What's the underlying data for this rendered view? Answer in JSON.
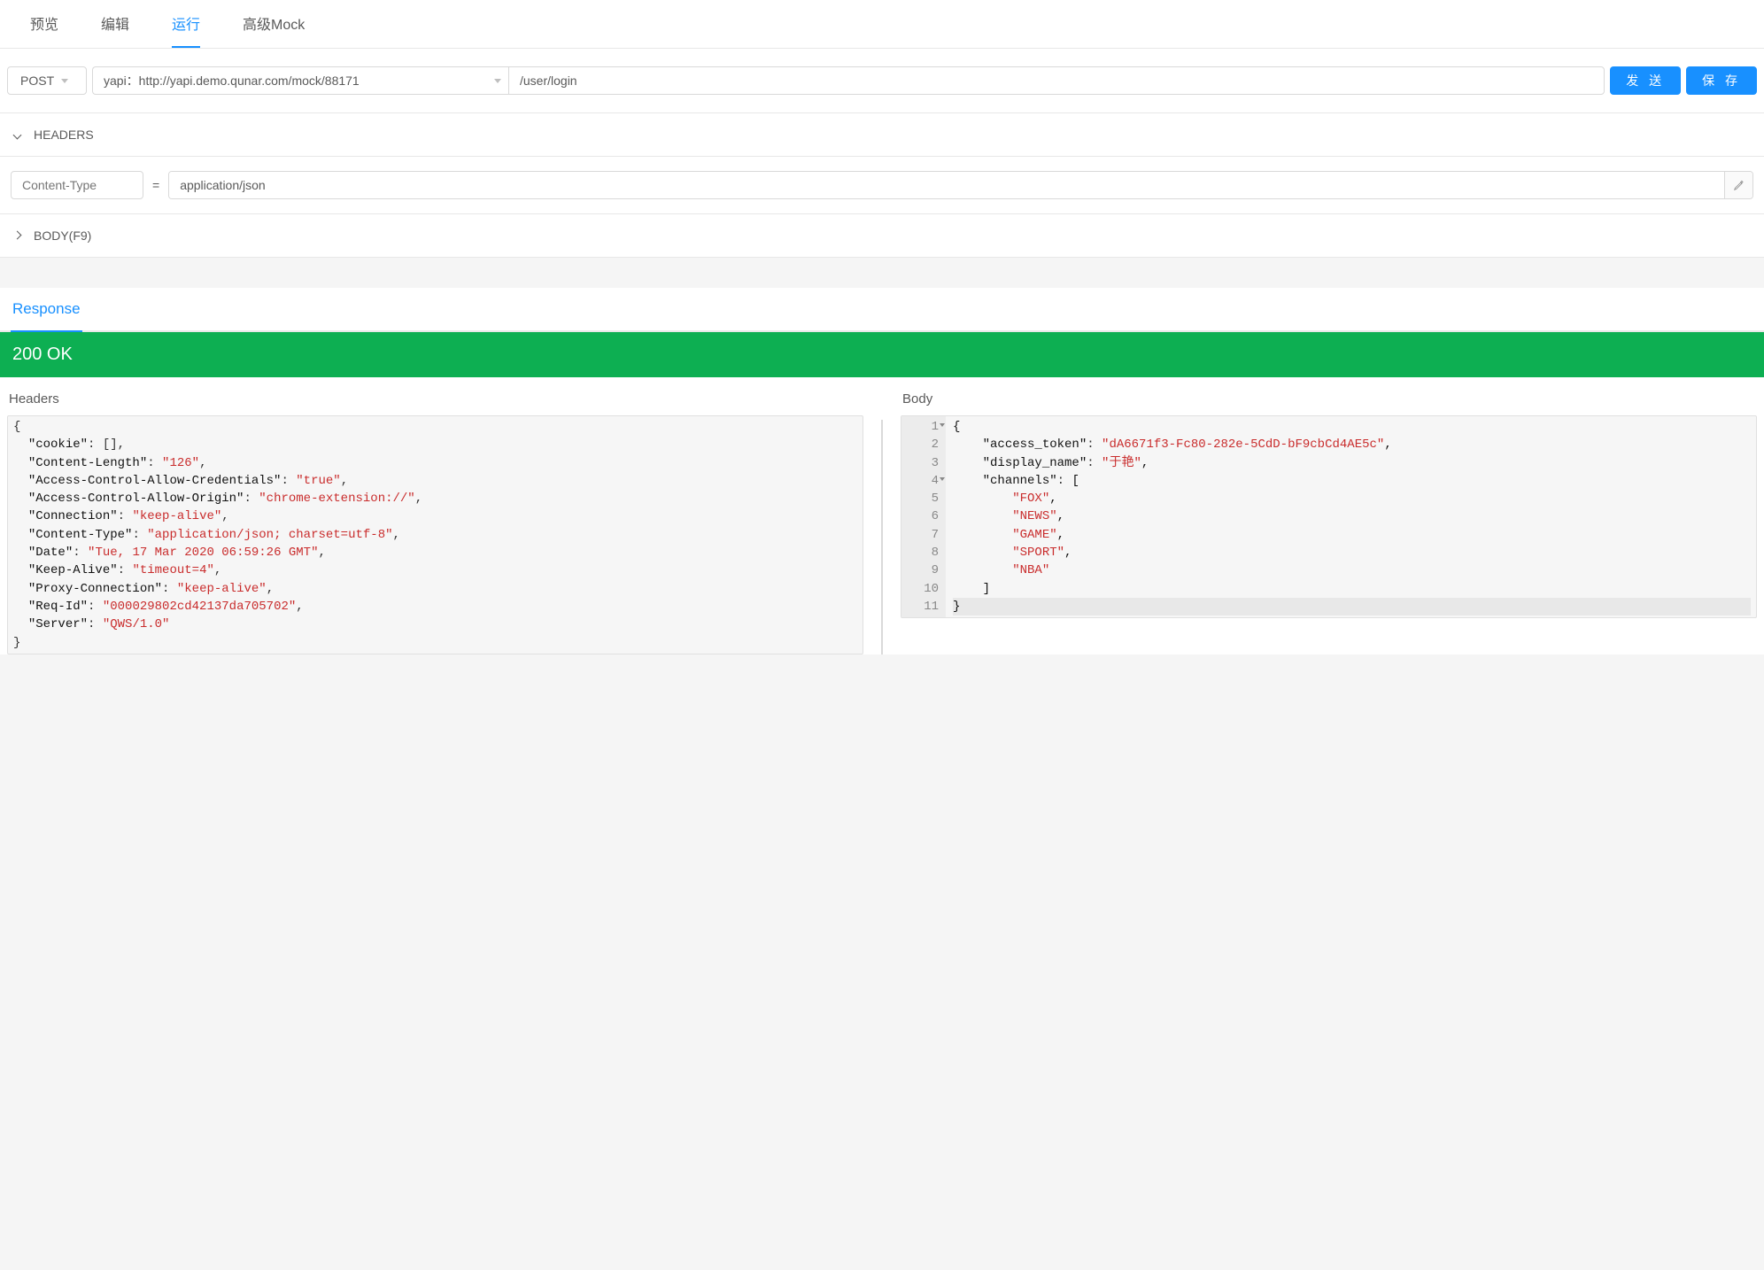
{
  "tabs": {
    "preview": "预览",
    "edit": "编辑",
    "run": "运行",
    "advanced_mock": "高级Mock",
    "active": "run"
  },
  "request": {
    "method": "POST",
    "env": "yapi：http://yapi.demo.qunar.com/mock/88171",
    "path": "/user/login",
    "send_label": "发 送",
    "save_label": "保 存"
  },
  "sections": {
    "headers_label": "HEADERS",
    "body_label": "BODY(F9)"
  },
  "header_row": {
    "key_placeholder": "Content-Type",
    "key_value": "",
    "value": "application/json"
  },
  "response": {
    "tab_label": "Response",
    "status": "200 OK",
    "headers_title": "Headers",
    "body_title": "Body",
    "headers_json": {
      "cookie": [],
      "Content-Length": "126",
      "Access-Control-Allow-Credentials": "true",
      "Access-Control-Allow-Origin": "chrome-extension://",
      "Connection": "keep-alive",
      "Content-Type": "application/json; charset=utf-8",
      "Date": "Tue, 17 Mar 2020 06:59:26 GMT",
      "Keep-Alive": "timeout=4",
      "Proxy-Connection": "keep-alive",
      "Req-Id": "000029802cd42137da705702",
      "Server": "QWS/1.0"
    },
    "body_json": {
      "access_token": "dA6671f3-Fc80-282e-5CdD-bF9cbCd4AE5c",
      "display_name": "于艳",
      "channels": [
        "FOX",
        "NEWS",
        "GAME",
        "SPORT",
        "NBA"
      ]
    }
  }
}
